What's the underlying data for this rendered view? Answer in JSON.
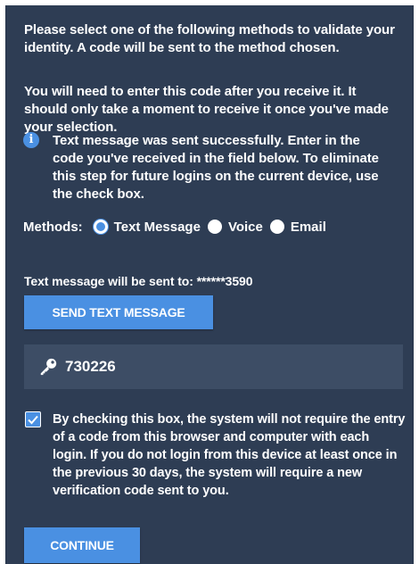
{
  "intro": {
    "line1": "Please select one of the following methods to validate your identity. A code will be sent to the method chosen.",
    "line2": "You will need to enter this code after you receive it. It should only take a moment to receive it once you've made your selection."
  },
  "info": {
    "icon": "info-icon",
    "message": "Text message was sent successfully. Enter in the code you've received in the field below. To eliminate this step for future logins on the current device, use the check box."
  },
  "methods": {
    "label": "Methods:",
    "selected": "Text Message",
    "options": [
      {
        "label": "Text Message",
        "selected": true
      },
      {
        "label": "Voice",
        "selected": false
      },
      {
        "label": "Email",
        "selected": false
      }
    ]
  },
  "send_to": {
    "text": "Text message will be sent to: ******3590"
  },
  "buttons": {
    "send_label": "SEND TEXT MESSAGE",
    "continue_label": "CONTINUE"
  },
  "code_field": {
    "icon": "key-icon",
    "value": "730226"
  },
  "remember": {
    "checked": true,
    "text": "By checking this box, the system will not require the entry of a code from this browser and computer with each login. If you do not login from this device at least once in the previous 30 days, the system will require a new verification code sent to you."
  },
  "colors": {
    "panel_bg": "#2e3d54",
    "accent": "#4a90e2",
    "field_bg": "#3d4d65",
    "text": "#ffffff"
  }
}
